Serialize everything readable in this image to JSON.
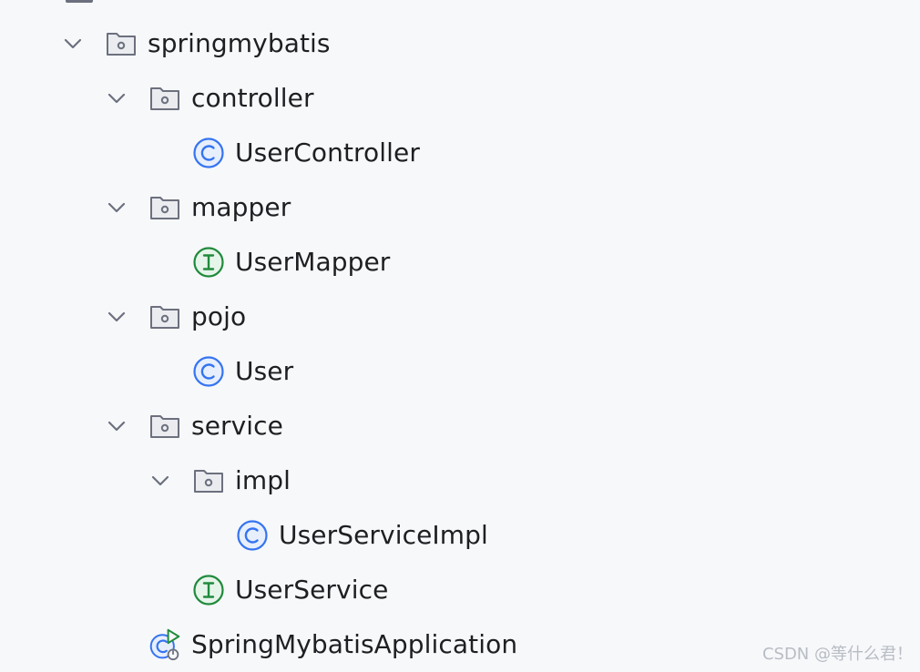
{
  "tree": {
    "rows": [
      {
        "id": "springmybatis",
        "label": "springmybatis",
        "kind": "folder",
        "expanded": true
      },
      {
        "id": "controller",
        "label": "controller",
        "kind": "folder",
        "expanded": true
      },
      {
        "id": "usercontroller",
        "label": "UserController",
        "kind": "class"
      },
      {
        "id": "mapper",
        "label": "mapper",
        "kind": "folder",
        "expanded": true
      },
      {
        "id": "usermapper",
        "label": "UserMapper",
        "kind": "interface"
      },
      {
        "id": "pojo",
        "label": "pojo",
        "kind": "folder",
        "expanded": true
      },
      {
        "id": "user",
        "label": "User",
        "kind": "class"
      },
      {
        "id": "service",
        "label": "service",
        "kind": "folder",
        "expanded": true
      },
      {
        "id": "impl",
        "label": "impl",
        "kind": "folder",
        "expanded": true
      },
      {
        "id": "userserviceimpl",
        "label": "UserServiceImpl",
        "kind": "class"
      },
      {
        "id": "userservice",
        "label": "UserService",
        "kind": "interface"
      },
      {
        "id": "springmybatisapplication",
        "label": "SpringMybatisApplication",
        "kind": "spring-boot-app"
      }
    ]
  },
  "watermark": "CSDN @等什么君！",
  "colors": {
    "background": "#f7f8fa",
    "folder_stroke": "#6c707e",
    "class_icon": "#3574f0",
    "interface_icon": "#208a3c",
    "run_icon": "#208a3c",
    "chevron": "#6c707e"
  }
}
